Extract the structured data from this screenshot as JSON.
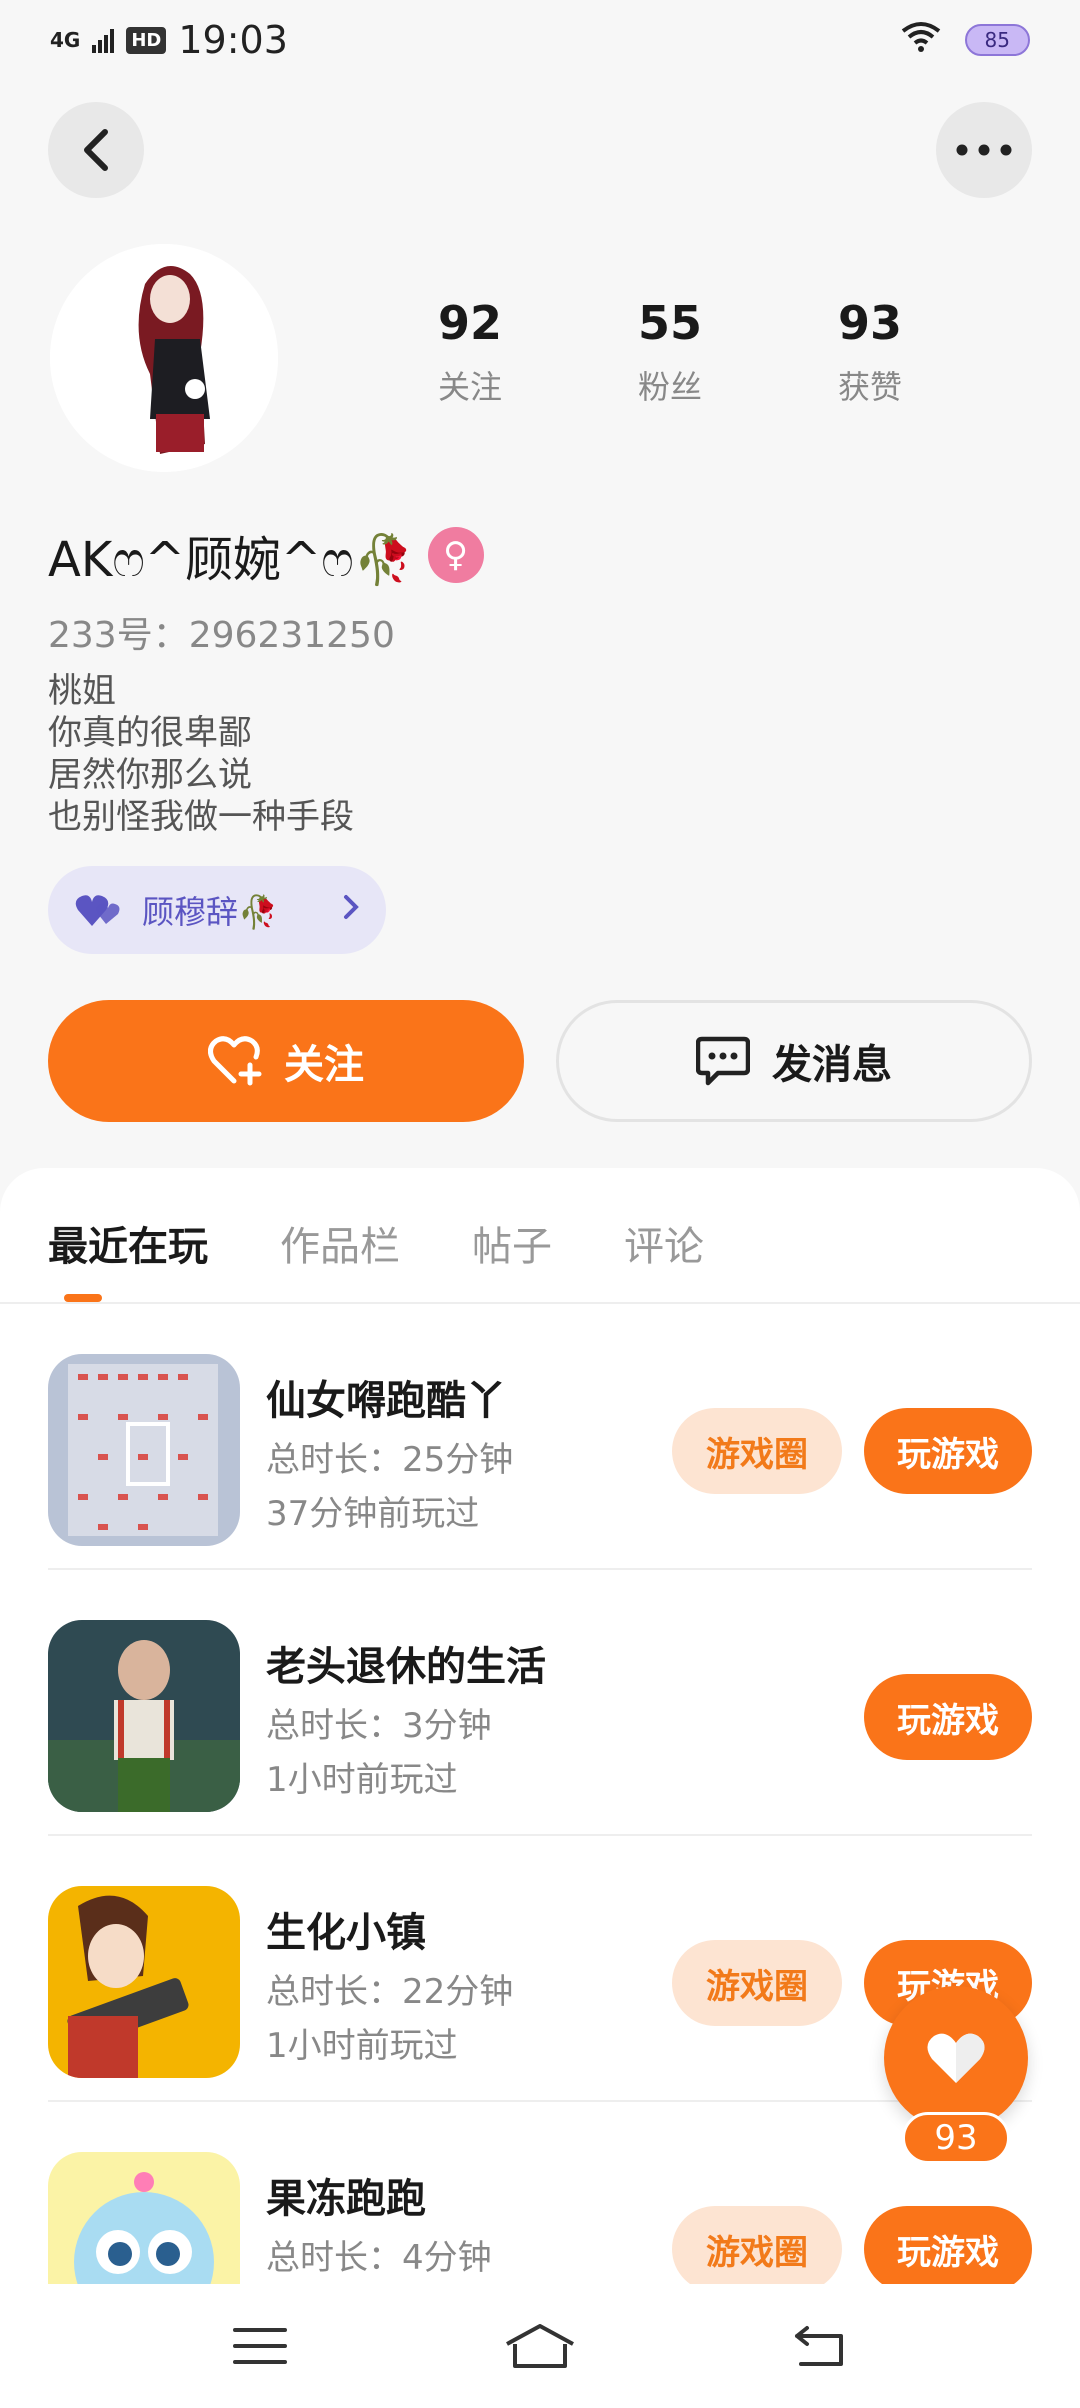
{
  "status_bar": {
    "network": "4G",
    "hd": "HD",
    "time": "19:03",
    "battery": "85",
    "wifi_icon": "wifi-icon"
  },
  "header": {
    "back_icon": "back-arrow-icon",
    "more_icon": "more-icon"
  },
  "profile": {
    "nickname": "AKෆ^顾婉^ෆ🥀",
    "gender_symbol": "♀",
    "id_text": "233号：296231250",
    "bio": [
      "桃姐",
      "你真的很卑鄙",
      "居然你那么说",
      "也别怪我做一种手段"
    ],
    "relation": {
      "label": "顾穆辞🥀",
      "icon": "double-heart-icon"
    }
  },
  "stats": [
    {
      "num": "92",
      "label": "关注"
    },
    {
      "num": "55",
      "label": "粉丝"
    },
    {
      "num": "93",
      "label": "获赞"
    }
  ],
  "actions": {
    "follow_label": "关注",
    "message_label": "发消息"
  },
  "tabs": [
    "最近在玩",
    "作品栏",
    "帖子",
    "评论"
  ],
  "games": [
    {
      "title": "仙女嘚跑酷丫",
      "duration": "总时长：25分钟",
      "last_played": "37分钟前玩过",
      "circle_label": "游戏圈",
      "play_label": "玩游戏"
    },
    {
      "title": "老头退休的生活",
      "duration": "总时长：3分钟",
      "last_played": "1小时前玩过",
      "circle_label": "",
      "play_label": "玩游戏"
    },
    {
      "title": "生化小镇",
      "duration": "总时长：22分钟",
      "last_played": "1小时前玩过",
      "circle_label": "游戏圈",
      "play_label": "玩游戏"
    },
    {
      "title": "果冻跑跑",
      "duration": "总时长：4分钟",
      "last_played": "",
      "circle_label": "游戏圈",
      "play_label": "玩游戏"
    }
  ],
  "like_fab": {
    "count": "93"
  },
  "colors": {
    "accent": "#fa7419",
    "accent_light": "#fde4d2",
    "relation_bg": "#e7e6f7",
    "relation_text": "#5b55c2"
  }
}
